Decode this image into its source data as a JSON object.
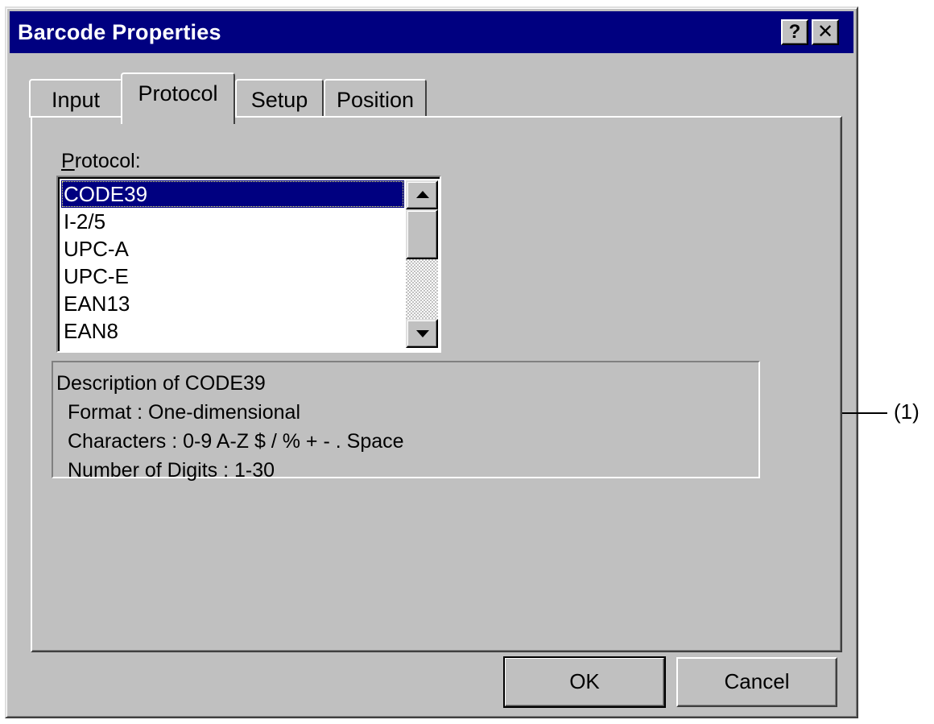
{
  "window": {
    "title": "Barcode Properties",
    "help_button": "?",
    "close_button": "✕"
  },
  "tabs": [
    {
      "label": "Input",
      "active": false
    },
    {
      "label": "Protocol",
      "active": true
    },
    {
      "label": "Setup",
      "active": false
    },
    {
      "label": "Position",
      "active": false
    }
  ],
  "protocol": {
    "label_mnemonic": "P",
    "label_rest": "rotocol:",
    "items": [
      "CODE39",
      "I-2/5",
      "UPC-A",
      "UPC-E",
      "EAN13",
      "EAN8"
    ],
    "selected": "CODE39"
  },
  "description": {
    "heading": "Description of CODE39",
    "format": "Format : One-dimensional",
    "characters": "Characters : 0-9 A-Z $ / % + - . Space",
    "digits": "Number of Digits : 1-30"
  },
  "buttons": {
    "ok": "OK",
    "cancel": "Cancel"
  },
  "callout": "(1)",
  "colors": {
    "title_bar": "#000080",
    "face": "#c0c0c0",
    "selection": "#000080"
  }
}
